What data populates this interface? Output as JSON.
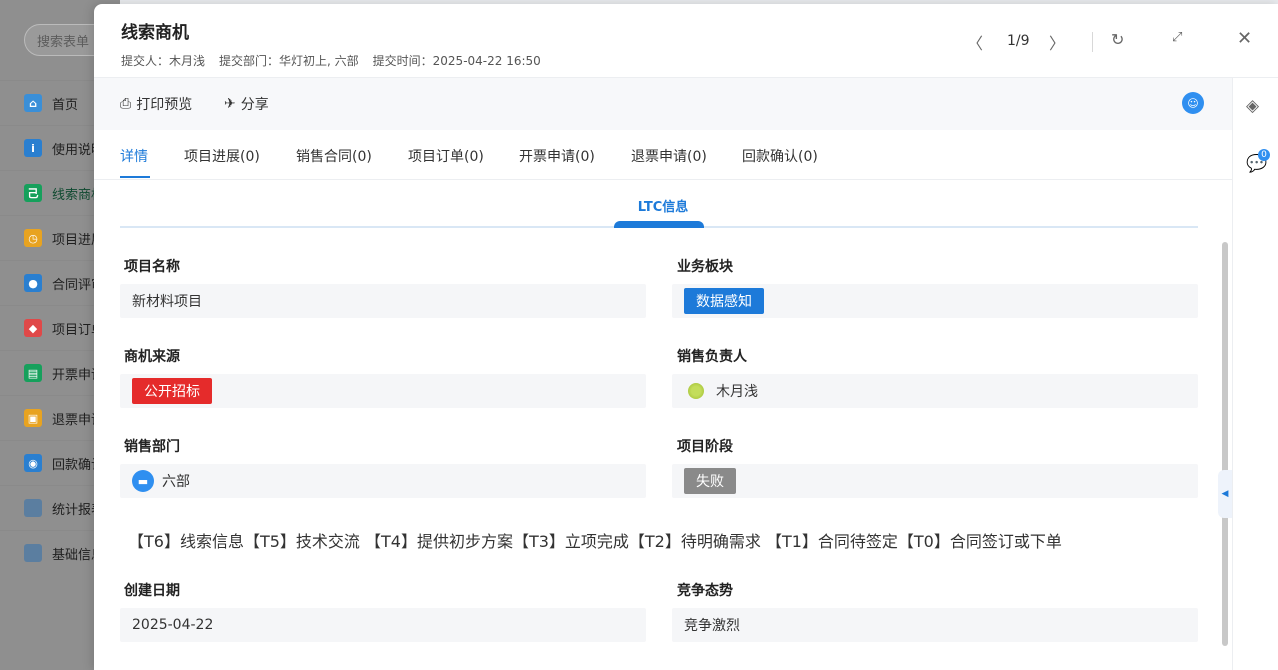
{
  "background": {
    "search_placeholder": "搜索表单",
    "nav": [
      {
        "label": "首页",
        "icon": "home-icon",
        "color": "#3a8fd8"
      },
      {
        "label": "使用说明",
        "icon": "info-icon",
        "color": "#2a7fd0"
      },
      {
        "label": "线索商机",
        "icon": "lead-icon",
        "color": "#16a05c"
      },
      {
        "label": "项目进展",
        "icon": "clock-icon",
        "color": "#e8a320"
      },
      {
        "label": "合同评审",
        "icon": "user-icon",
        "color": "#2a7fd0"
      },
      {
        "label": "项目订单",
        "icon": "tag-icon",
        "color": "#e04848"
      },
      {
        "label": "开票申请",
        "icon": "invoice-icon",
        "color": "#16a05c"
      },
      {
        "label": "退票申请",
        "icon": "refund-icon",
        "color": "#e8a320"
      },
      {
        "label": "回款确认",
        "icon": "payment-icon",
        "color": "#2a7fd0"
      },
      {
        "label": "统计报表",
        "icon": "folder-icon",
        "color": "#5b7ea0"
      },
      {
        "label": "基础信息",
        "icon": "folder-icon",
        "color": "#5b7ea0"
      }
    ]
  },
  "header": {
    "title": "线索商机",
    "submitter": "提交人：木月浅",
    "department": "提交部门：华灯初上, 六部",
    "time": "提交时间：2025-04-22 16:50",
    "pager": "1/9"
  },
  "toolbar": {
    "print_label": "打印预览",
    "share_label": "分享"
  },
  "tabs": [
    {
      "label": "详情"
    },
    {
      "label": "项目进展(0)"
    },
    {
      "label": "销售合同(0)"
    },
    {
      "label": "项目订单(0)"
    },
    {
      "label": "开票申请(0)"
    },
    {
      "label": "退票申请(0)"
    },
    {
      "label": "回款确认(0)"
    }
  ],
  "right_rail": {
    "comment_count": "0"
  },
  "section": {
    "title": "LTC信息"
  },
  "fields": {
    "project_name": {
      "label": "项目名称",
      "value": "新材料项目"
    },
    "business_segment": {
      "label": "业务板块",
      "value": "数据感知"
    },
    "opportunity_source": {
      "label": "商机来源",
      "value": "公开招标"
    },
    "sales_owner": {
      "label": "销售负责人",
      "value": "木月浅"
    },
    "sales_dept": {
      "label": "销售部门",
      "value": "六部"
    },
    "project_stage": {
      "label": "项目阶段",
      "value": "失败"
    },
    "stage_legend": "【T6】线索信息【T5】技术交流 【T4】提供初步方案【T3】立项完成【T2】待明确需求 【T1】合同待签定【T0】合同签订或下单",
    "created_date": {
      "label": "创建日期",
      "value": "2025-04-22"
    },
    "competition": {
      "label": "竞争态势",
      "value": "竞争激烈"
    }
  },
  "colors": {
    "accent": "#1d7ad9",
    "danger": "#e52b2b",
    "muted": "#8a8a8a"
  }
}
